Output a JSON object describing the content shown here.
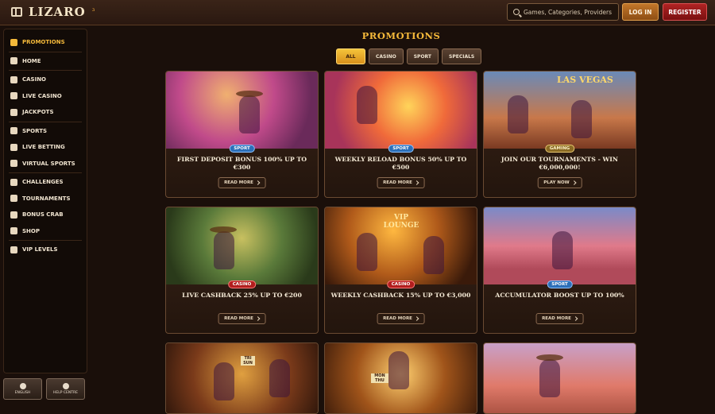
{
  "header": {
    "brand": "LIZARO",
    "brand_sup": "³",
    "search_placeholder": "Games, Categories, Providers",
    "login_label": "LOG IN",
    "register_label": "REGISTER"
  },
  "sidebar": {
    "items": [
      {
        "label": "PROMOTIONS",
        "icon": "gift-icon",
        "active": true
      },
      {
        "label": "HOME",
        "icon": "home-icon"
      },
      {
        "label": "CASINO",
        "icon": "slot-icon"
      },
      {
        "label": "LIVE CASINO",
        "icon": "cards-icon"
      },
      {
        "label": "JACKPOTS",
        "icon": "clover-icon"
      },
      {
        "label": "SPORTS",
        "icon": "ball-icon"
      },
      {
        "label": "LIVE BETTING",
        "icon": "play-icon"
      },
      {
        "label": "VIRTUAL SPORTS",
        "icon": "gamepad-icon"
      },
      {
        "label": "CHALLENGES",
        "icon": "medal-icon"
      },
      {
        "label": "TOURNAMENTS",
        "icon": "trophy-icon"
      },
      {
        "label": "BONUS CRAB",
        "icon": "crab-icon"
      },
      {
        "label": "SHOP",
        "icon": "shop-icon"
      },
      {
        "label": "VIP LEVELS",
        "icon": "diamond-icon"
      }
    ],
    "language_label": "ENGLISH",
    "help_label": "HELP CENTRE"
  },
  "main": {
    "title": "PROMOTIONS",
    "filters": [
      "ALL",
      "CASINO",
      "SPORT",
      "SPECIALS"
    ],
    "cards": [
      {
        "tag": "SPORT",
        "title": "FIRST DEPOSIT BONUS 100% UP TO €300",
        "button": "READ MORE"
      },
      {
        "tag": "SPORT",
        "title": "WEEKLY RELOAD BONUS 50% UP TO €500",
        "button": "READ MORE"
      },
      {
        "tag": "GAMING",
        "title": "JOIN OUR TOURNAMENTS - WIN €6,000,000!",
        "button": "PLAY NOW"
      },
      {
        "tag": "CASINO",
        "title": "LIVE CASHBACK 25% UP TO €200",
        "button": "READ MORE"
      },
      {
        "tag": "CASINO",
        "title": "WEEKLY CASHBACK 15% UP TO €3,000",
        "button": "READ MORE"
      },
      {
        "tag": "SPORT",
        "title": "ACCUMULATOR BOOST UP TO 100%",
        "button": "READ MORE"
      }
    ],
    "image_text": {
      "vegas": "LAS VEGAS",
      "vip": "VIP LOUNGE",
      "days1": "TRI SUN",
      "days2": "MON THU"
    }
  }
}
